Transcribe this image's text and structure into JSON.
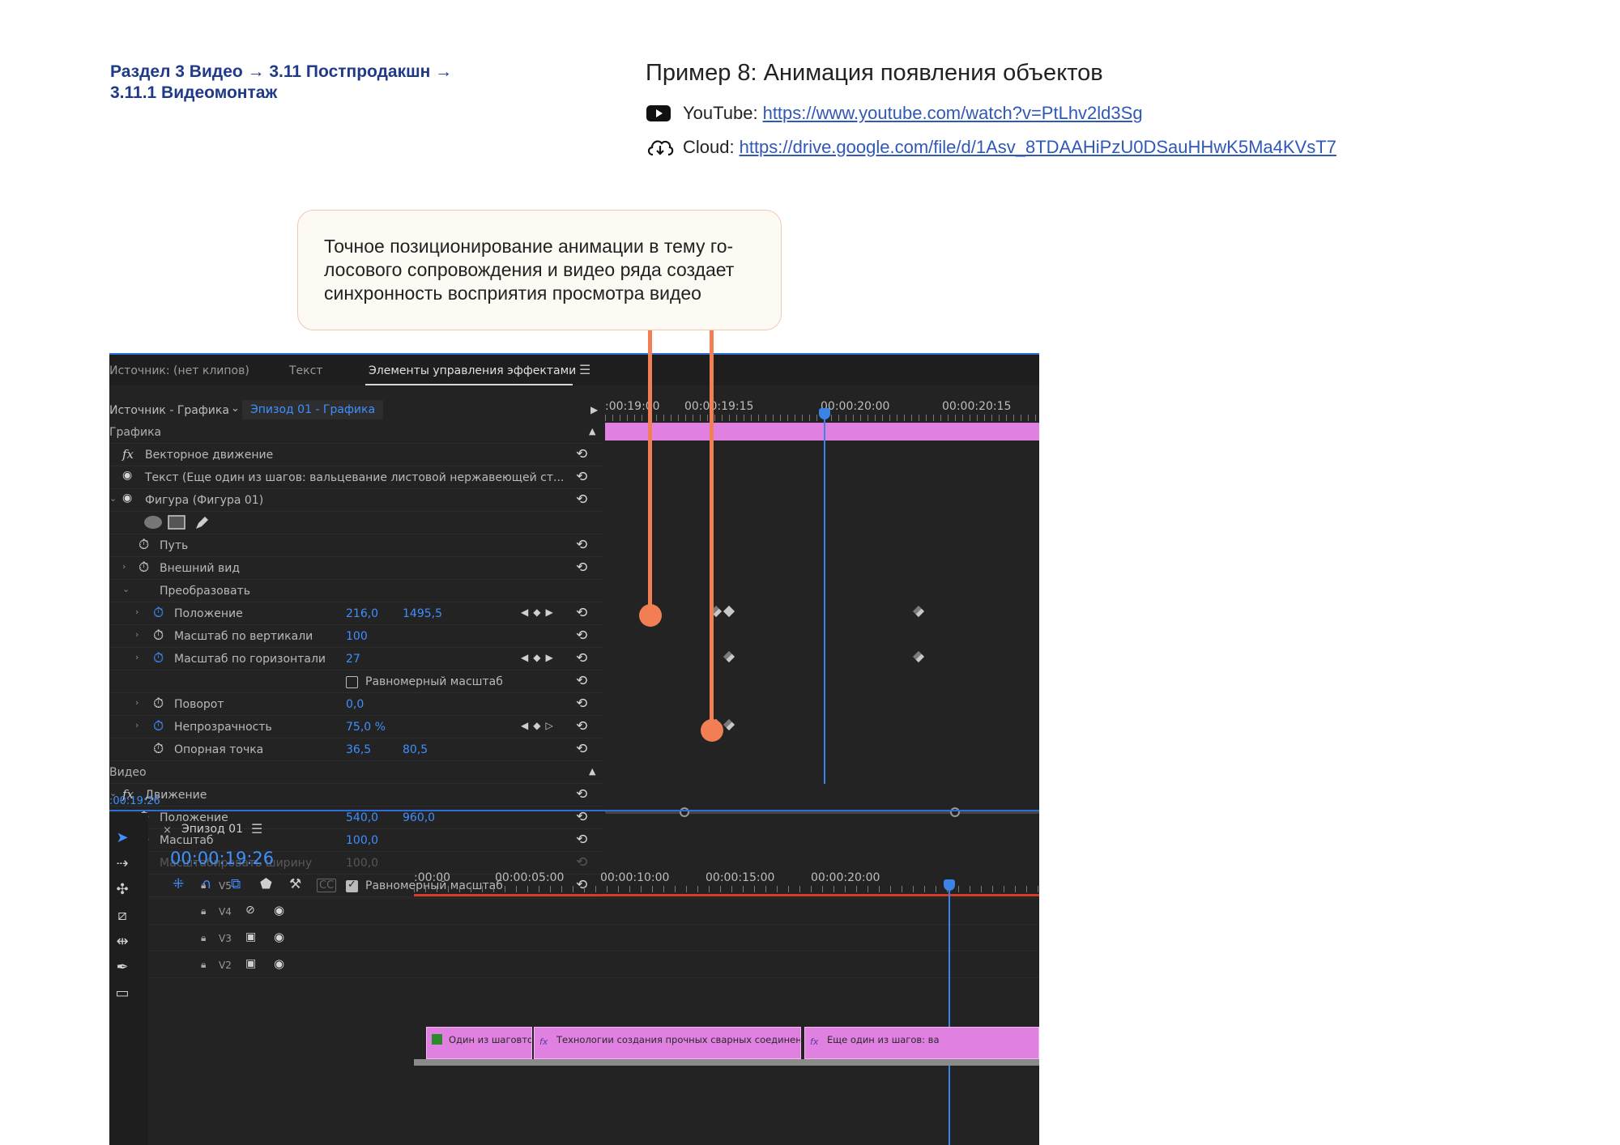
{
  "breadcrumb": {
    "text": "Раздел 3 Видео  → 3.11 Постпродакшн → 3.11.1 Видеомонтаж"
  },
  "example": {
    "title": "Пример 8: Анимация появления объектов",
    "youtube_label": "YouTube:",
    "youtube_url": "https://www.youtube.com/watch?v=PtLhv2ld3Sg",
    "cloud_label": "Cloud:",
    "cloud_url": "https://drive.google.com/file/d/1Asv_8TDAAHiPzU0DSauHHwK5Ma4KVsT7"
  },
  "callout": {
    "text": "Точное позиционирование анимации в тему го-лосового сопровождения и видео ряда создает синхронность восприятия просмотра видео"
  },
  "colors": {
    "accent": "#f27e54",
    "link": "#2f58b7",
    "breadcrumb": "#1f3a8a",
    "premiere_blue": "#3f8fff",
    "clip_pink": "#e080e0"
  },
  "effect_controls": {
    "tabs": [
      "Источник: (нет клипов)",
      "Текст",
      "Элементы управления эффектами"
    ],
    "source_left": "Источник - Графика",
    "source_right": "Эпизод 01 - Графика",
    "rows": [
      {
        "label": "Графика"
      },
      {
        "label": "Векторное движение"
      },
      {
        "label": "Текст (Еще один из шагов: вальцевание листовой нержавеющей ст..."
      },
      {
        "label": "Фигура (Фигура 01)"
      },
      {
        "label": ""
      },
      {
        "label": "Путь"
      },
      {
        "label": "Внешний вид"
      },
      {
        "label": "Преобразовать"
      },
      {
        "label": "Положение",
        "v1": "216,0",
        "v2": "1495,5"
      },
      {
        "label": "Масштаб по вертикали",
        "v1": "100"
      },
      {
        "label": "Масштаб по горизонтали",
        "v1": "27"
      },
      {
        "label": "Равномерный масштаб"
      },
      {
        "label": "Поворот",
        "v1": "0,0"
      },
      {
        "label": "Непрозрачность",
        "v1": "75,0 %"
      },
      {
        "label": "Опорная точка",
        "v1": "36,5",
        "v2": "80,5"
      },
      {
        "label": "Видео"
      },
      {
        "label": "Движение"
      },
      {
        "label": "Положение",
        "v1": "540,0",
        "v2": "960,0"
      },
      {
        "label": "Масштаб",
        "v1": "100,0"
      },
      {
        "label": "Масштабировать ширину",
        "v1": "100,0"
      },
      {
        "label": "Равномерный масштаб"
      }
    ],
    "ruler": [
      ":00:19:00",
      "00:00:19:15",
      "00:00:20:00",
      "00:00:20:15"
    ],
    "timecode": ":00:19:26",
    "icons": [
      "reset-icon",
      "stopwatch-icon",
      "eye-icon",
      "fx-icon",
      "ellipse-icon",
      "rectangle-icon",
      "pen-icon",
      "keyframe-icon"
    ]
  },
  "sequence": {
    "name": "Эпизод 01",
    "timecode": "00:00:19:26",
    "ruler": [
      ":00:00",
      "00:00:05:00",
      "00:00:10:00",
      "00:00:15:00",
      "00:00:20:00"
    ],
    "tracks": [
      "V5",
      "V4",
      "V3",
      "V2"
    ],
    "clips": [
      "Один из шаговточна",
      "Технологии создания прочных сварных соединений служат деся",
      "Еще один из шагов: ва"
    ]
  }
}
